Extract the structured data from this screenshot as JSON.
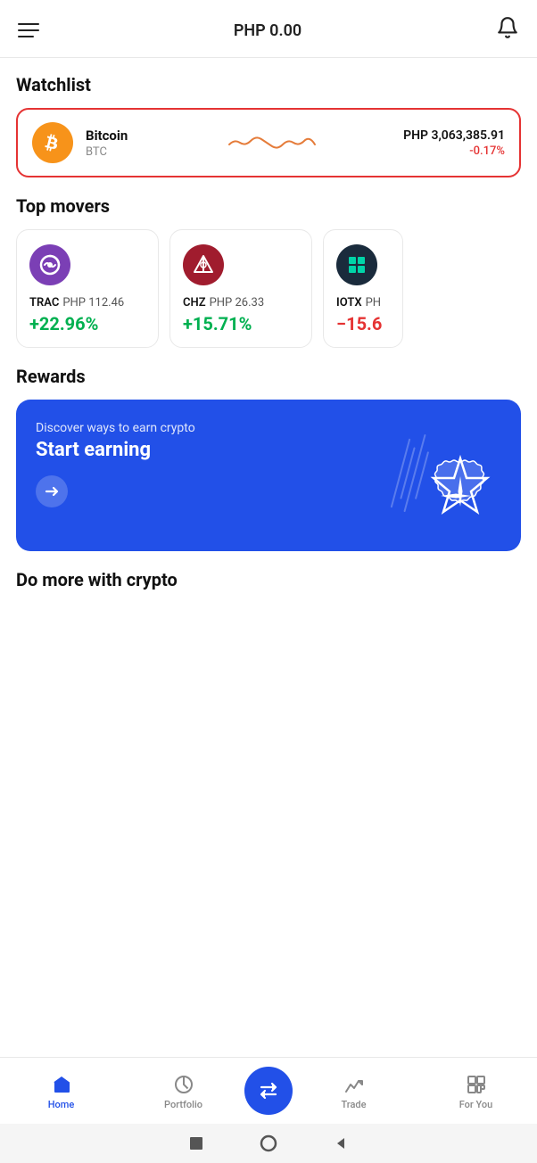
{
  "header": {
    "balance": "PHP 0.00",
    "menu_label": "menu",
    "bell_label": "notifications"
  },
  "watchlist": {
    "title": "Watchlist",
    "item": {
      "name": "Bitcoin",
      "symbol": "BTC",
      "price": "PHP 3,063,385.91",
      "change": "-0.17%"
    }
  },
  "top_movers": {
    "title": "Top movers",
    "items": [
      {
        "symbol": "TRAC",
        "price": "PHP 112.46",
        "change": "+22.96%",
        "positive": true,
        "color_class": "trac"
      },
      {
        "symbol": "CHZ",
        "price": "PHP 26.33",
        "change": "+15.71%",
        "positive": true,
        "color_class": "chz"
      },
      {
        "symbol": "IOTX",
        "price": "PH...",
        "change": "-15.6...",
        "positive": false,
        "color_class": "iotx"
      }
    ]
  },
  "rewards": {
    "title": "Rewards",
    "subtitle": "Discover ways to earn crypto",
    "cta": "Start earning",
    "arrow": "→"
  },
  "do_more": {
    "title": "Do more with crypto"
  },
  "bottom_nav": {
    "items": [
      {
        "label": "Home",
        "icon": "home",
        "active": true
      },
      {
        "label": "Portfolio",
        "icon": "portfolio",
        "active": false
      },
      {
        "label": "",
        "icon": "swap",
        "active": false,
        "center": true
      },
      {
        "label": "Trade",
        "icon": "trade",
        "active": false
      },
      {
        "label": "For You",
        "icon": "foryou",
        "active": false
      }
    ]
  },
  "system_bar": {
    "square_label": "square",
    "circle_label": "circle",
    "back_label": "back"
  }
}
